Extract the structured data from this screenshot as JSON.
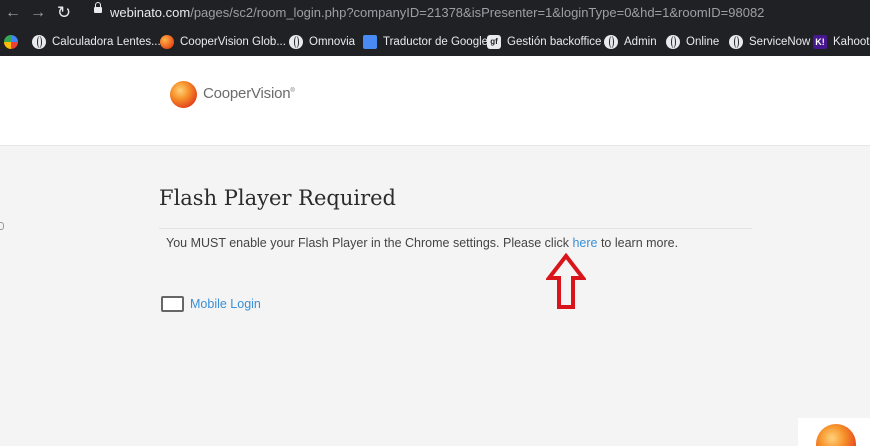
{
  "browser": {
    "url_domain": "webinato.com",
    "url_path": "/pages/sc2/room_login.php?companyID=21378&isPresenter=1&loginType=0&hd=1&roomID=98082",
    "bookmarks": [
      {
        "label": "Calculadora Lentes...",
        "icon": "globe-icon"
      },
      {
        "label": "CooperVision Glob...",
        "icon": "coopervision-icon"
      },
      {
        "label": "Omnovia",
        "icon": "globe-icon"
      },
      {
        "label": "Traductor de Google",
        "icon": "translate-icon"
      },
      {
        "label": "Gestión backoffice",
        "icon": "gb-icon"
      },
      {
        "label": "Admin",
        "icon": "globe-icon"
      },
      {
        "label": "Online",
        "icon": "globe-icon"
      },
      {
        "label": "ServiceNow",
        "icon": "globe-icon"
      },
      {
        "label": "Kahoot!",
        "icon": "kahoot-icon"
      }
    ]
  },
  "header": {
    "brand": "CooperVision",
    "brand_mark": "®"
  },
  "main": {
    "title": "Flash Player Required",
    "message_before": "You MUST enable your Flash Player in the Chrome settings. Please click ",
    "message_link": "here",
    "message_after": " to learn more.",
    "mobile_login_label": "Mobile Login"
  },
  "colors": {
    "link": "#3b8fd6",
    "arrow": "#d9151b",
    "chrome_bg": "#202124"
  }
}
